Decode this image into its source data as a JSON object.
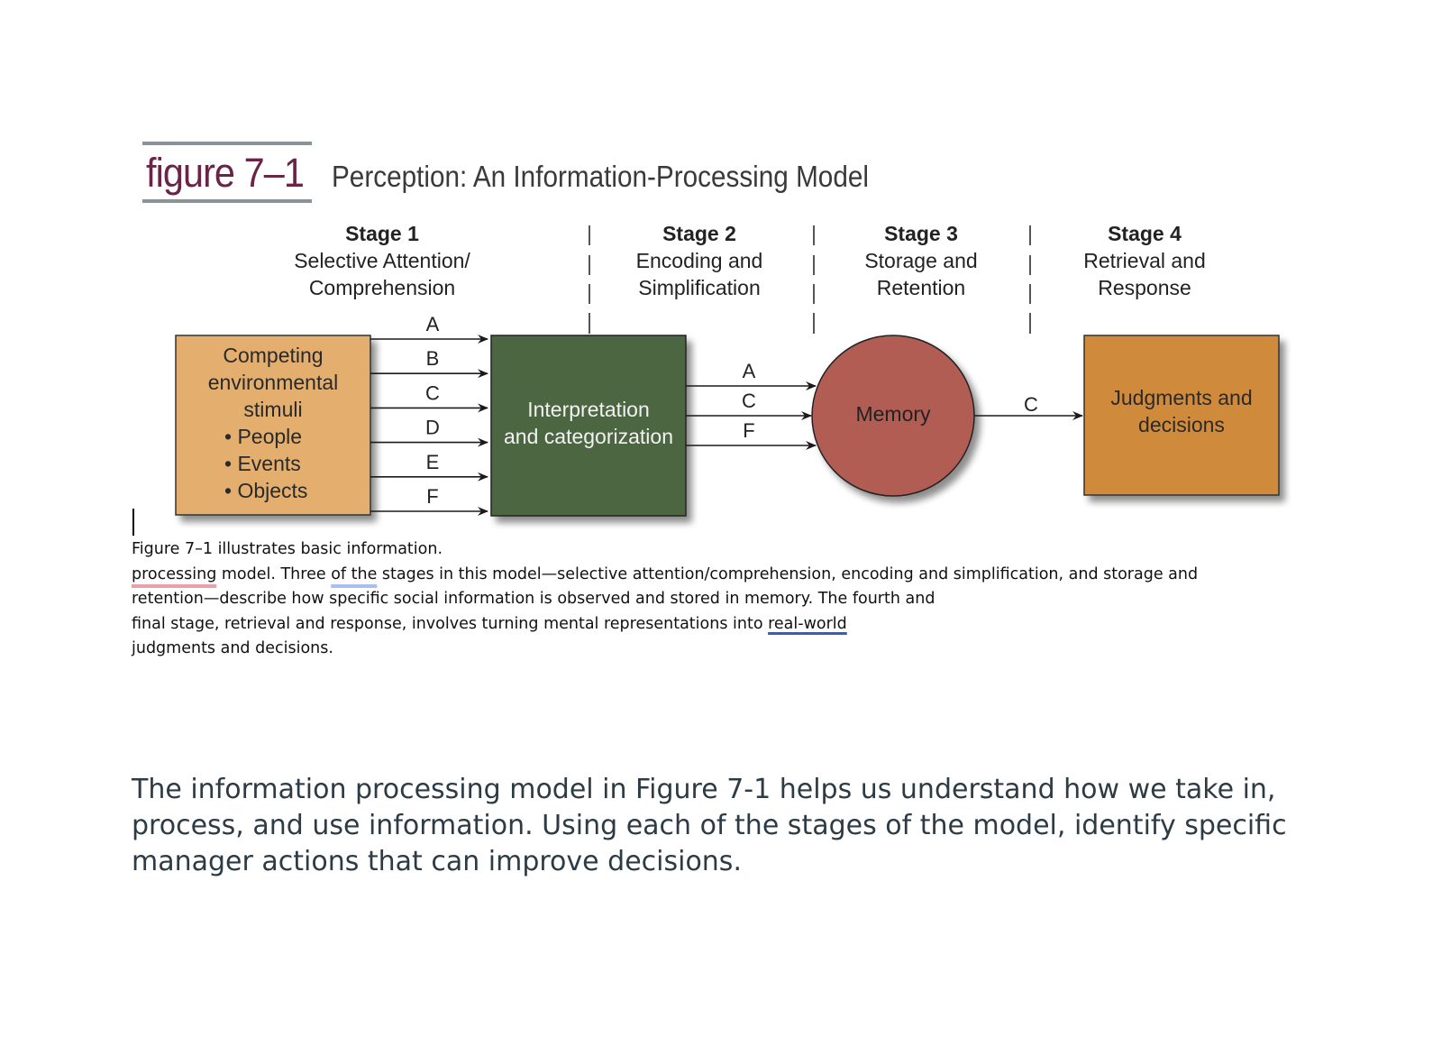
{
  "figure": {
    "label": "figure 7–1",
    "title": "Perception: An Information-Processing Model",
    "label_color": "#6b2447",
    "stages": [
      {
        "name": "Stage 1",
        "desc_lines": [
          "Selective Attention/",
          "Comprehension"
        ]
      },
      {
        "name": "Stage 2",
        "desc_lines": [
          "Encoding and",
          "Simplification"
        ]
      },
      {
        "name": "Stage 3",
        "desc_lines": [
          "Storage and",
          "Retention"
        ]
      },
      {
        "name": "Stage 4",
        "desc_lines": [
          "Retrieval and",
          "Response"
        ]
      }
    ],
    "nodes": {
      "stimuli": {
        "lines": [
          "Competing",
          "environmental",
          "stimuli",
          "• People",
          "• Events",
          "• Objects"
        ],
        "color": "#e4ae6e"
      },
      "interpretation": {
        "lines": [
          "Interpretation",
          "and categorization"
        ],
        "color": "#4e6642"
      },
      "memory": {
        "label": "Memory",
        "color": "#b15d53"
      },
      "judgments": {
        "lines": [
          "Judgments and",
          "decisions"
        ],
        "color": "#d08a3b"
      }
    },
    "edges": {
      "stimuli_to_interpretation": [
        "A",
        "B",
        "C",
        "D",
        "E",
        "F"
      ],
      "interpretation_to_memory": [
        "A",
        "C",
        "F"
      ],
      "memory_to_judgments": [
        "C"
      ]
    }
  },
  "caption": {
    "lines": [
      [
        {
          "t": "Figure 7–1 illustrates basic information."
        }
      ],
      [
        {
          "t": "processing",
          "u": "red"
        },
        {
          "t": " model. Three "
        },
        {
          "t": "of the",
          "u": "blue"
        },
        {
          "t": " stages in this model—selective attention/comprehension, encoding and simplification, and storage and"
        }
      ],
      [
        {
          "t": "retention—describe how specific social information is observed and stored in memory. The fourth and"
        }
      ],
      [
        {
          "t": "final stage, retrieval and response, involves turning mental representations into "
        },
        {
          "t": "real-world",
          "u": "dblue"
        }
      ],
      [
        {
          "t": "judgments and decisions."
        }
      ]
    ]
  },
  "question": {
    "lines": [
      "The information processing model in Figure 7-1 helps us understand how we take in,",
      "process, and use information.  Using each of the stages of the model, identify specific",
      "manager actions that can improve decisions."
    ],
    "color": "#2d3b45"
  }
}
